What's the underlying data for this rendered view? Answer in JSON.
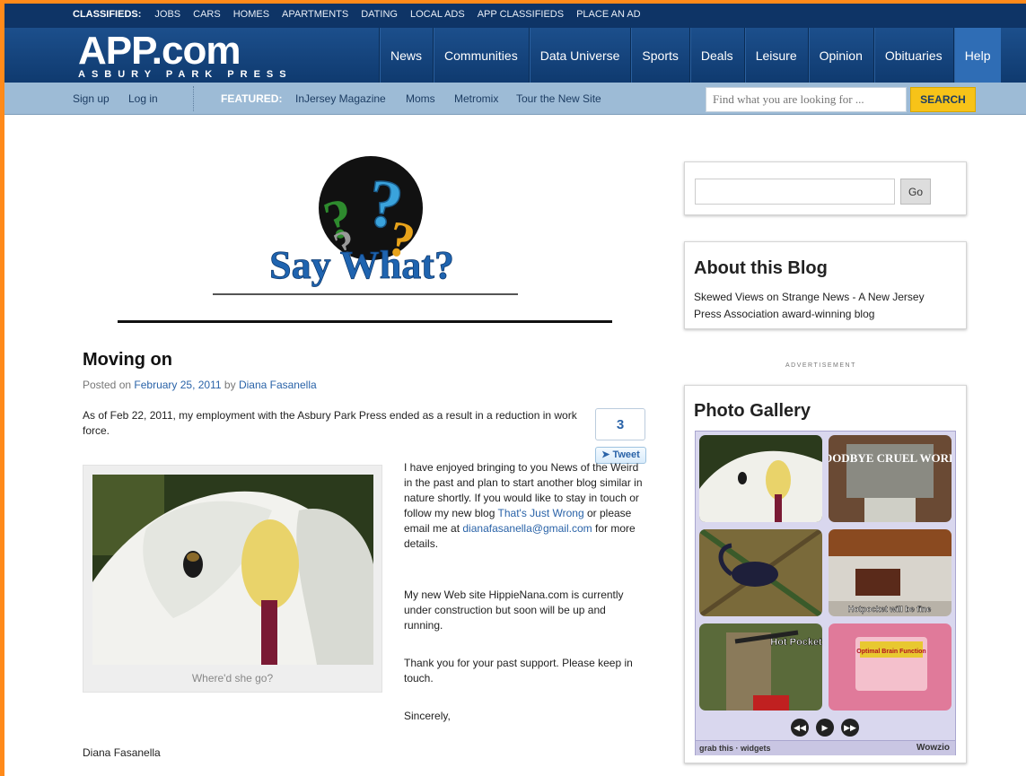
{
  "topbar": {
    "lead": "CLASSIFIEDS:",
    "items": [
      "JOBS",
      "CARS",
      "HOMES",
      "APARTMENTS",
      "DATING",
      "LOCAL ADS",
      "APP CLASSIFIEDS",
      "PLACE AN AD"
    ]
  },
  "logo": {
    "main": "APP.com",
    "sub": "ASBURY PARK PRESS"
  },
  "mainnav": [
    "News",
    "Communities",
    "Data Universe",
    "Sports",
    "Deals",
    "Leisure",
    "Opinion",
    "Obituaries",
    "Help"
  ],
  "subnav": {
    "signup": "Sign up",
    "login": "Log in",
    "featured_label": "FEATURED:",
    "featured": [
      "InJersey Magazine",
      "Moms",
      "Metromix",
      "Tour the New Site"
    ],
    "search_placeholder": "Find what you are looking for ...",
    "search_button": "SEARCH"
  },
  "blog": {
    "logo_text": "Say What?"
  },
  "post": {
    "title": "Moving on",
    "meta_posted": "Posted on",
    "meta_date": "February 25, 2011",
    "meta_by": "by",
    "meta_author": "Diana Fasanella",
    "intro": "As of Feb 22, 2011, my employment with the Asbury Park Press ended as a result in a reduction in work force.",
    "tweet_count": "3",
    "tweet_label": "Tweet",
    "p1_a": "I have enjoyed bringing to you News of the Weird in the past and plan to start another blog similar in nature shortly. If you would like to stay in touch or follow my new blog",
    "p1_link": "That's Just Wrong",
    "p1_b": "or please email me at",
    "p1_email": "dianafasanella@gmail.com",
    "p1_c": "for more details.",
    "p2": "My new Web site HippieNana.com is currently under construction but soon will be up and running.",
    "p3": "Thank you for your past support. Please keep in touch.",
    "p4": "Sincerely,",
    "signoff": "Diana Fasanella",
    "caption": "Where'd she go?"
  },
  "sidebar": {
    "go_label": "Go",
    "about_title": "About this Blog",
    "about_text": "Skewed Views on Strange News - A New Jersey Press Association award-winning blog",
    "ad_label": "ADVERTISEMENT",
    "gallery_title": "Photo Gallery",
    "thumb_texts": [
      "GOODBYE CRUEL WORLD",
      "Hotpocket will be fine",
      "Hot Pocket",
      "Optimal Brain Function"
    ],
    "gallery_footer_left": "grab this · widgets",
    "gallery_footer_right": "Wowzio"
  },
  "colors": {
    "accent": "#2a63a8",
    "navy": "#0e3466",
    "search_yellow": "#f7c318",
    "frame_orange": "#ff8a1a"
  }
}
